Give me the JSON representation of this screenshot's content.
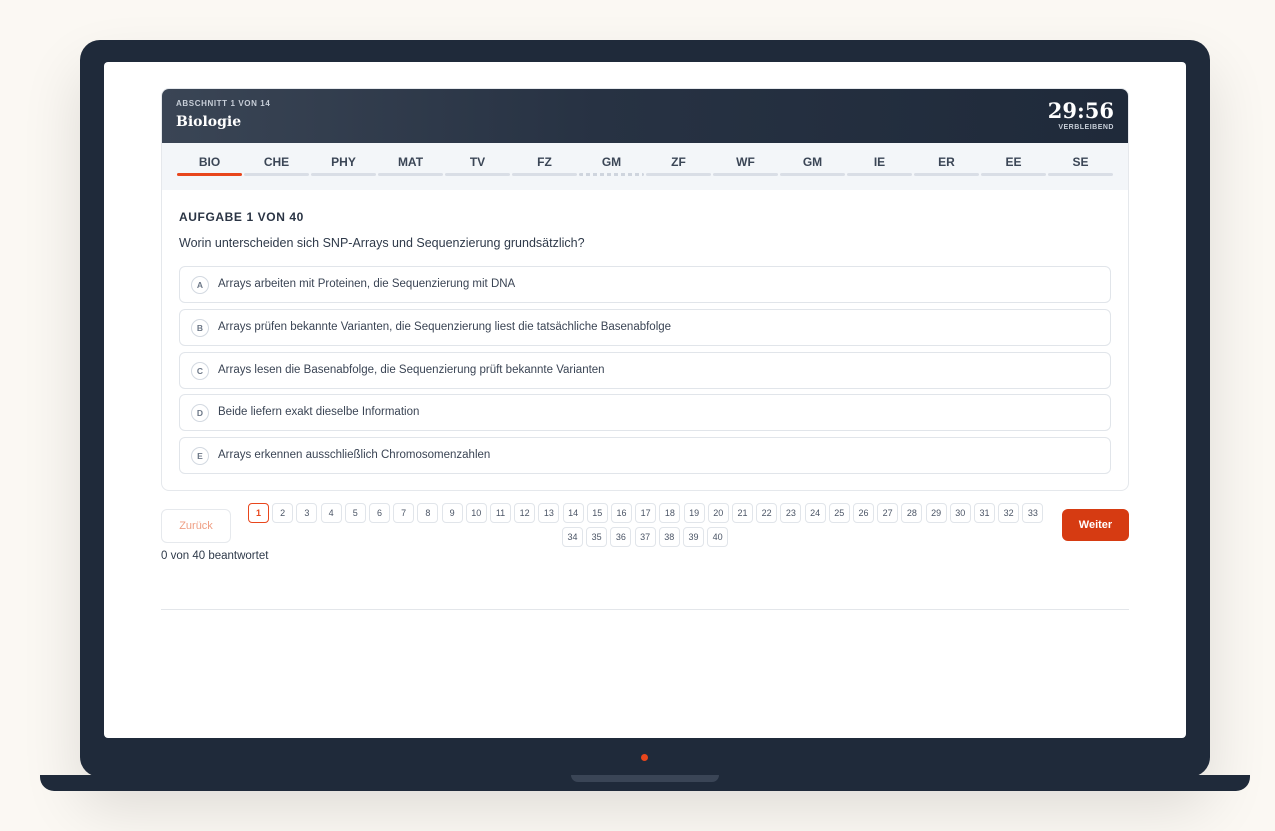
{
  "header": {
    "section_kicker": "ABSCHNITT 1 VON 14",
    "section_title": "Biologie",
    "timer": "29:56",
    "timer_label": "VERBLEIBEND"
  },
  "tabs": [
    {
      "label": "BIO",
      "active": true
    },
    {
      "label": "CHE",
      "active": false
    },
    {
      "label": "PHY",
      "active": false
    },
    {
      "label": "MAT",
      "active": false
    },
    {
      "label": "TV",
      "active": false
    },
    {
      "label": "FZ",
      "active": false
    },
    {
      "label": "GM",
      "active": false
    },
    {
      "label": "ZF",
      "active": false
    },
    {
      "label": "WF",
      "active": false
    },
    {
      "label": "GM",
      "active": false
    },
    {
      "label": "IE",
      "active": false
    },
    {
      "label": "ER",
      "active": false
    },
    {
      "label": "EE",
      "active": false
    },
    {
      "label": "SE",
      "active": false
    }
  ],
  "task": {
    "label": "AUFGABE 1 VON 40",
    "question": "Worin unterscheiden sich SNP-Arrays und Sequenzierung grundsätzlich?",
    "options": [
      {
        "letter": "A",
        "text": "Arrays arbeiten mit Proteinen, die Sequenzierung mit DNA"
      },
      {
        "letter": "B",
        "text": "Arrays prüfen bekannte Varianten, die Sequenzierung liest die tatsächliche Basenabfolge"
      },
      {
        "letter": "C",
        "text": "Arrays lesen die Basenabfolge, die Sequenzierung prüft bekannte Varianten"
      },
      {
        "letter": "D",
        "text": "Beide liefern exakt dieselbe Information"
      },
      {
        "letter": "E",
        "text": "Arrays erkennen ausschließlich Chromosomenzahlen"
      }
    ]
  },
  "navigation": {
    "back_label": "Zurück",
    "next_label": "Weiter",
    "answered_status": "0 von 40 beantwortet",
    "current_page": 1,
    "pages": [
      "1",
      "2",
      "3",
      "4",
      "5",
      "6",
      "7",
      "8",
      "9",
      "10",
      "11",
      "12",
      "13",
      "14",
      "15",
      "16",
      "17",
      "18",
      "19",
      "20",
      "21",
      "22",
      "23",
      "24",
      "25",
      "26",
      "27",
      "28",
      "29",
      "30",
      "31",
      "32",
      "33",
      "34",
      "35",
      "36",
      "37",
      "38",
      "39",
      "40"
    ]
  },
  "colors": {
    "accent": "#e8461c",
    "primary_button": "#d63b12",
    "header_dark": "#1f2a3a"
  }
}
